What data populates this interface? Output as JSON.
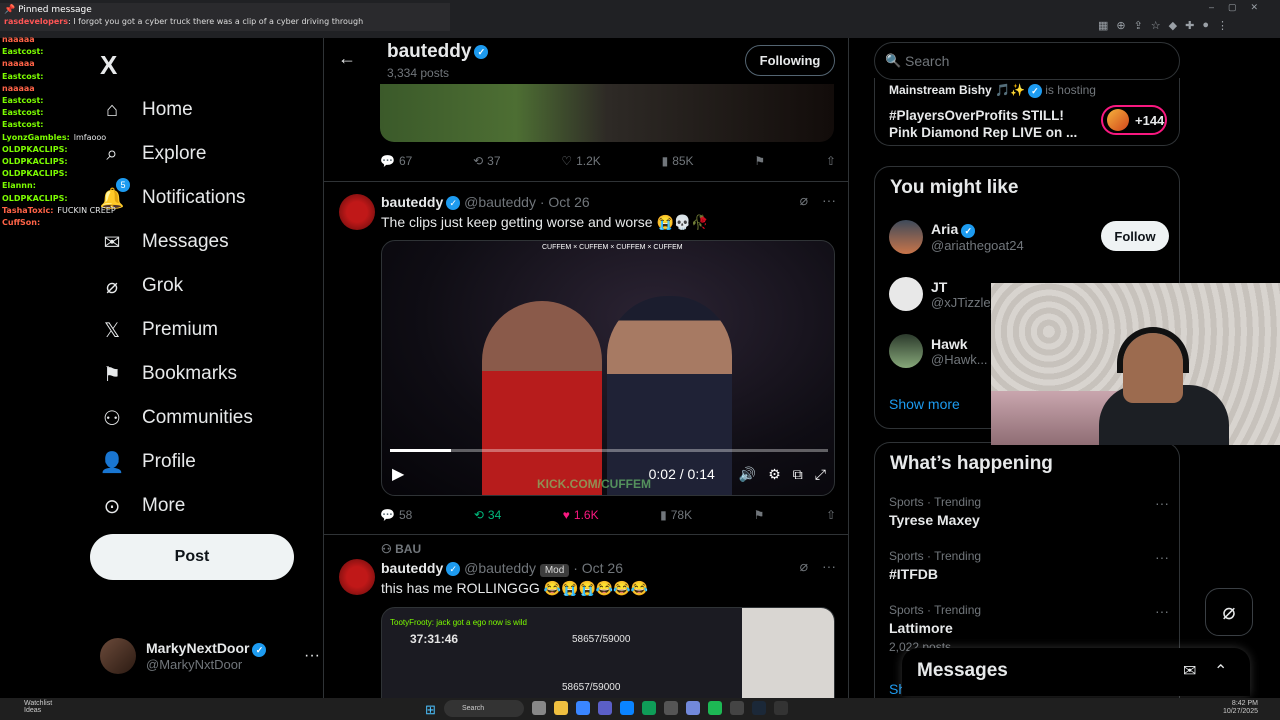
{
  "chat": {
    "pinned_title": "Pinned message",
    "pinned_user": "rasdevelopers",
    "pinned_text": ": I forgot you got a cyber truck there was a clip of a cyber driving through",
    "lines": [
      {
        "user": "naaaaa",
        "msg": ""
      },
      {
        "user": "Eastcost:",
        "msg": ""
      },
      {
        "user": "naaaaa",
        "msg": ""
      },
      {
        "user": "Eastcost:",
        "msg": ""
      },
      {
        "user": "naaaaa",
        "msg": ""
      },
      {
        "user": "Eastcost:",
        "msg": ""
      },
      {
        "user": "Eastcost:",
        "msg": ""
      },
      {
        "user": "Eastcost:",
        "msg": ""
      },
      {
        "user": "LyonzGambles:",
        "msg": "lmfaooo"
      },
      {
        "user": "OLDPKACLIPS:",
        "msg": ""
      },
      {
        "user": "OLDPKACLIPS:",
        "msg": ""
      },
      {
        "user": "OLDPKACLIPS:",
        "msg": ""
      },
      {
        "user": "Elannn:",
        "msg": ""
      },
      {
        "user": "OLDPKACLIPS:",
        "msg": ""
      },
      {
        "user": "TashaToxic:",
        "msg": "FUCKIN CREEP"
      },
      {
        "user": "CuffSon:",
        "msg": ""
      }
    ]
  },
  "nav": {
    "logo": "X",
    "items": [
      {
        "label": "Home"
      },
      {
        "label": "Explore"
      },
      {
        "label": "Notifications",
        "badge": "5"
      },
      {
        "label": "Messages"
      },
      {
        "label": "Grok"
      },
      {
        "label": "Premium"
      },
      {
        "label": "Bookmarks"
      },
      {
        "label": "Communities"
      },
      {
        "label": "Profile"
      },
      {
        "label": "More"
      }
    ],
    "post_label": "Post",
    "account": {
      "name": "MarkyNextDoor",
      "handle": "@MarkyNxtDoor",
      "more": "···"
    }
  },
  "header": {
    "back": "←",
    "title": "bauteddy",
    "subtitle": "3,334 posts",
    "following_label": "Following"
  },
  "prev_actions": {
    "replies": "67",
    "reposts": "37",
    "likes": "1.2K",
    "views": "85K"
  },
  "tweet1": {
    "name": "bauteddy",
    "handle": "@bauteddy",
    "date": "· Oct 26",
    "text": "The clips just keep getting worse and worse 😭💀🥀",
    "video_top": "CUFFEM × CUFFEM × CUFFEM × CUFFEM",
    "video_time": "0:02 / 0:14",
    "video_watermark": "KICK.COM/CUFFEM",
    "progress": 0.14,
    "actions": {
      "replies": "58",
      "reposts": "34",
      "likes": "1.6K",
      "views": "78K"
    }
  },
  "tweet2": {
    "context": "BAU",
    "name": "bauteddy",
    "handle": "@bauteddy",
    "mod": "Mod",
    "date": "· Oct 26",
    "text": "this has me ROLLINGGG 😂😭😭😂😂😂",
    "img_line1": "TootyFrooty: jack got a ego now is wild",
    "img_timer": "37:31:46",
    "img_count": "58657/59000",
    "img_count2": "58657/59000"
  },
  "right": {
    "search_placeholder": "Search",
    "host": {
      "user": "Mainstream Bishy 🎵✨",
      "status": "is hosting",
      "title_line1": "#PlayersOverProfits STILL!",
      "title_line2": "Pink Diamond Rep LIVE on ...",
      "count": "+144"
    },
    "might_like": {
      "heading": "You might like",
      "people": [
        {
          "name": "Aria",
          "handle": "@ariathegoat24",
          "btn": "Follow"
        },
        {
          "name": "JT",
          "handle": "@xJTizzle_"
        },
        {
          "name": "Hawk",
          "handle": "@Hawk..."
        }
      ],
      "show_more": "Show more"
    },
    "happening": {
      "heading": "What’s happening",
      "trends": [
        {
          "cat": "Sports · Trending",
          "title": "Tyrese Maxey",
          "posts": ""
        },
        {
          "cat": "Sports · Trending",
          "title": "#ITFDB",
          "posts": ""
        },
        {
          "cat": "Sports · Trending",
          "title": "Lattimore",
          "posts": "2,022 posts"
        }
      ],
      "show": "Sh"
    }
  },
  "messages_drawer": {
    "title": "Messages"
  },
  "taskbar": {
    "watchlist": "Watchlist",
    "ideas": "Ideas",
    "search": "Search",
    "time": "8:42 PM",
    "date": "10/27/2025"
  },
  "colors": {
    "accent": "#1d9bf0",
    "like": "#f91880",
    "repost": "#00ba7c",
    "bg": "#000000",
    "border": "#2f3336"
  }
}
